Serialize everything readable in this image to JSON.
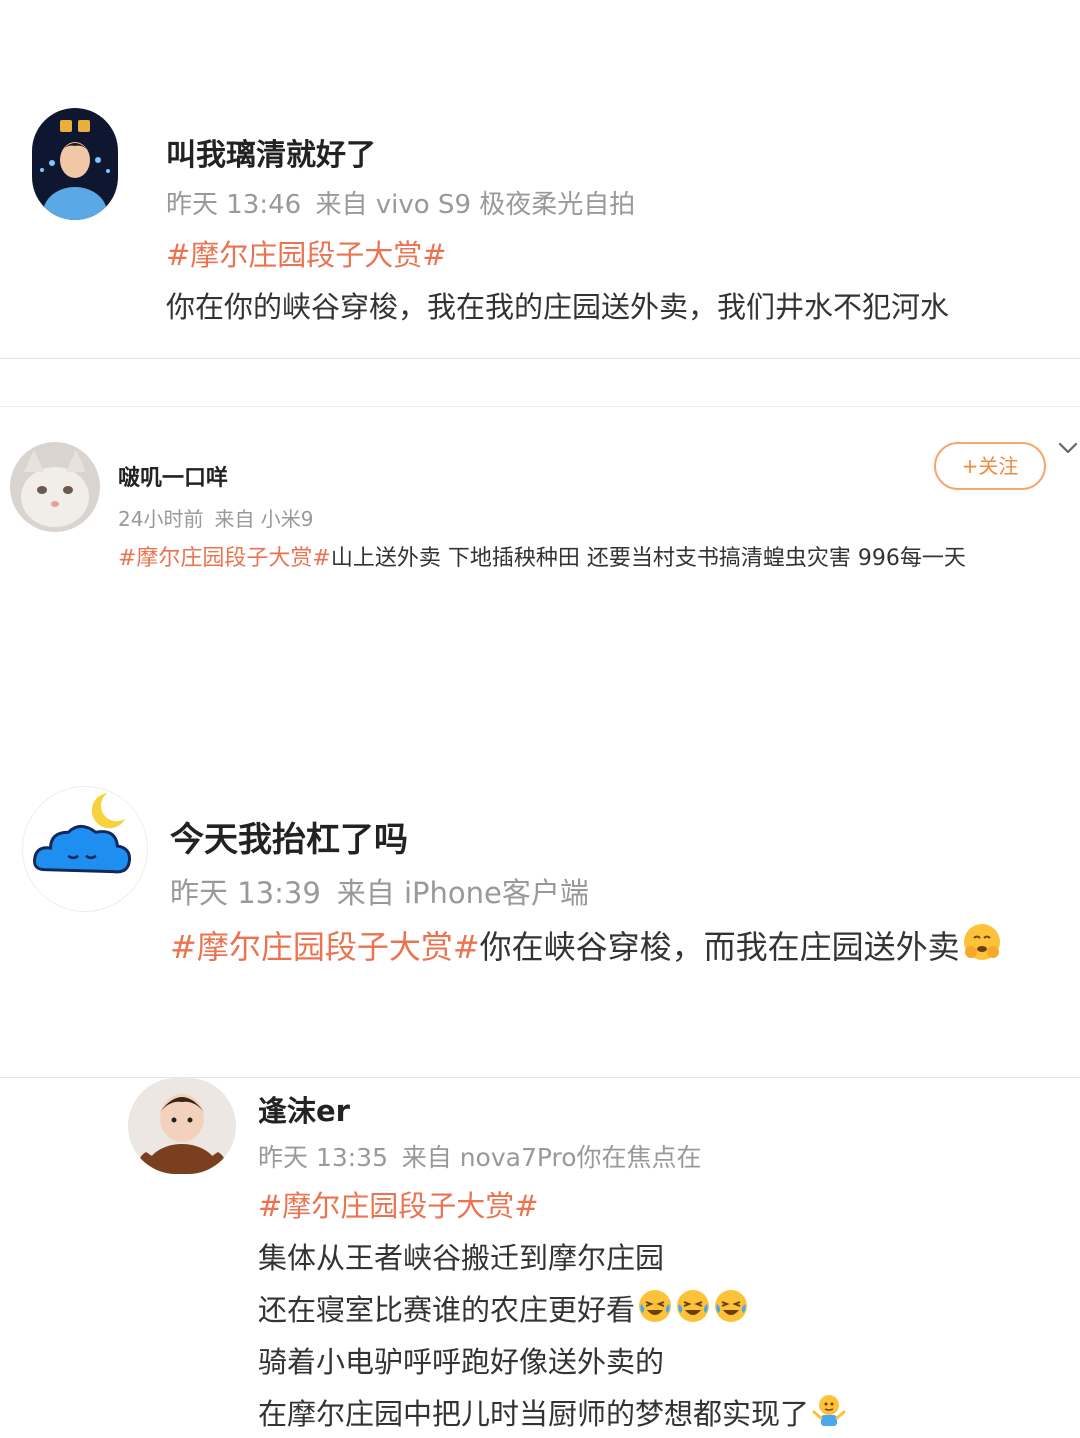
{
  "posts": [
    {
      "user": "叫我璃清就好了",
      "time": "昨天 13:46",
      "source": "来自 vivo S9 极夜柔光自拍",
      "tag": "#摩尔庄园段子大赏#",
      "lines": [
        "你在你的峡谷穿梭，我在我的庄园送外卖，我们井水不犯河水"
      ]
    },
    {
      "user": "啵叽一口咩",
      "time": "24小时前",
      "source": "来自 小米9",
      "tag": "#摩尔庄园段子大赏#",
      "text": "山上送外卖 下地插秧种田 还要当村支书搞清蝗虫灾害 996每一天",
      "follow_label": "+关注"
    },
    {
      "user": "今天我抬杠了吗",
      "time": "昨天 13:39",
      "source": "来自 iPhone客户端",
      "tag": "#摩尔庄园段子大赏#",
      "text": "你在峡谷穿梭，而我在庄园送外卖",
      "emoji": "blush-hands-emoji"
    },
    {
      "user": "逢沫er",
      "time": "昨天 13:35",
      "source": "来自 nova7Pro你在焦点在",
      "tag": "#摩尔庄园段子大赏#",
      "lines": [
        "集体从王者峡谷搬迁到摩尔庄园",
        "还在寝室比赛谁的农庄更好看",
        "骑着小电驴呼呼跑好像送外卖的",
        "在摩尔庄园中把儿时当厨师的梦想都实现了"
      ],
      "emojis": [
        "laughing-crying-emoji",
        "shrug-emoji"
      ]
    }
  ],
  "colors": {
    "tag": "#eb7350",
    "meta": "#999999",
    "follow_border": "#f6a770"
  }
}
